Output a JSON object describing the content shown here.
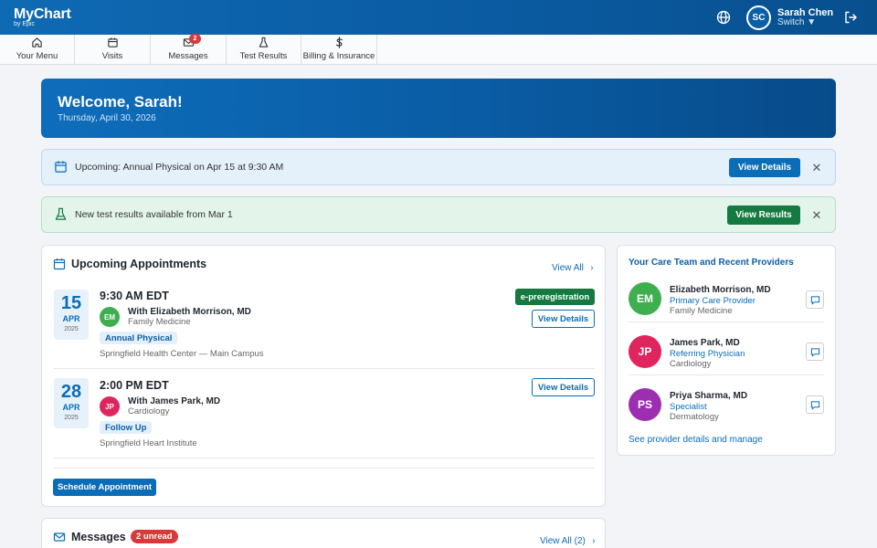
{
  "header": {
    "logo_main": "MyChart",
    "logo_sub": "by Epic",
    "user_initials": "SC",
    "user_name": "Sarah Chen",
    "switch_label": "Switch ▼"
  },
  "nav": {
    "items": [
      {
        "label": "Your Menu",
        "icon": "home-icon"
      },
      {
        "label": "Visits",
        "icon": "calendar-icon"
      },
      {
        "label": "Messages",
        "icon": "envelope-icon",
        "badge": "2"
      },
      {
        "label": "Test Results",
        "icon": "flask-icon"
      },
      {
        "label": "Billing & Insurance",
        "icon": "dollar-icon"
      }
    ]
  },
  "welcome": {
    "title": "Welcome, Sarah!",
    "date": "Thursday, April 30, 2026"
  },
  "alerts": {
    "appointment": {
      "text": "Upcoming: Annual Physical on Apr 15 at 9:30 AM",
      "button": "View Details",
      "close": "✕"
    },
    "results": {
      "text": "New test results available from Mar 1",
      "button": "View Results",
      "close": "✕"
    }
  },
  "appointments": {
    "title": "Upcoming Appointments",
    "view_all": "View All",
    "items": [
      {
        "day": "15",
        "month": "APR",
        "year": "2025",
        "time": "9:30 AM EDT",
        "initials": "EM",
        "with": "With Elizabeth Morrison, MD",
        "specialty": "Family Medicine",
        "type": "Annual Physical",
        "location": "Springfield Health Center — Main Campus",
        "tag": "e-preregistration",
        "button": "View Details"
      },
      {
        "day": "28",
        "month": "APR",
        "year": "2025",
        "time": "2:00 PM EDT",
        "initials": "JP",
        "with": "With James Park, MD",
        "specialty": "Cardiology",
        "type": "Follow Up",
        "location": "Springfield Heart Institute",
        "button": "View Details"
      }
    ],
    "schedule_button": "Schedule Appointment"
  },
  "care_team": {
    "title": "Your Care Team and Recent Providers",
    "providers": [
      {
        "initials": "EM",
        "name": "Elizabeth Morrison, MD",
        "role": "Primary Care Provider",
        "specialty": "Family Medicine"
      },
      {
        "initials": "JP",
        "name": "James Park, MD",
        "role": "Referring Physician",
        "specialty": "Cardiology"
      },
      {
        "initials": "PS",
        "name": "Priya Sharma, MD",
        "role": "Specialist",
        "specialty": "Dermatology"
      }
    ],
    "manage_link": "See provider details and manage"
  },
  "messages": {
    "title": "Messages",
    "unread": "2 unread",
    "view_all": "View All (2)"
  },
  "colors": {
    "brand_blue": "#0b6db7",
    "success_green": "#157a42",
    "alert_red": "#d63a3a",
    "avatar_em": "#3fae4f",
    "avatar_jp": "#e0245e",
    "avatar_ps": "#9c2fb0"
  }
}
